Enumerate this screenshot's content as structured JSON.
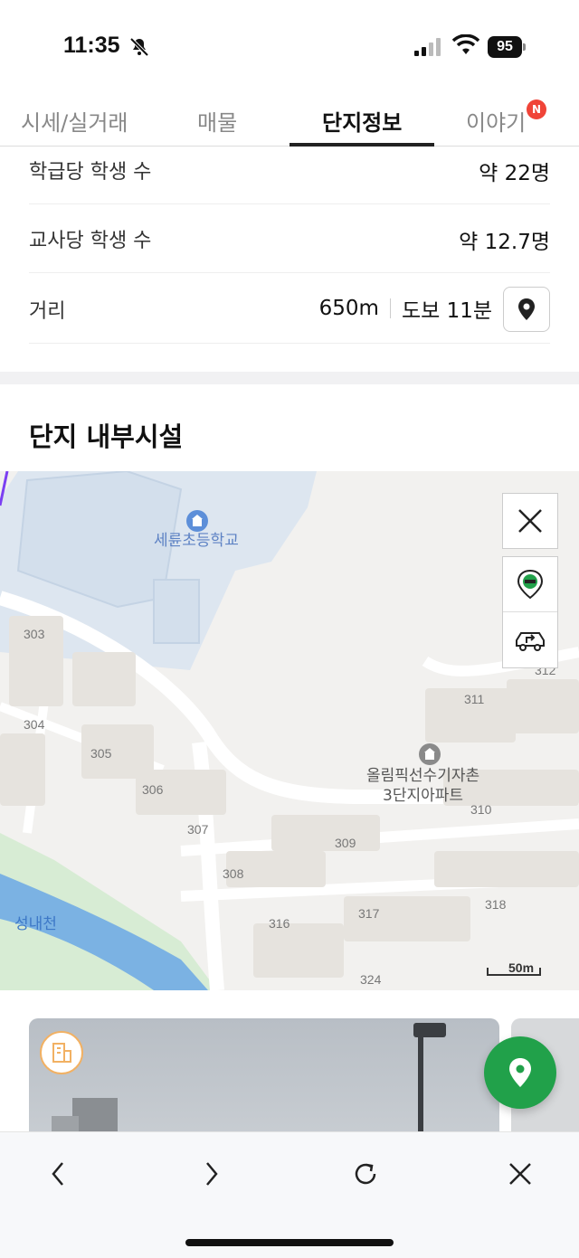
{
  "status_bar": {
    "time": "11:35",
    "battery": "95"
  },
  "tabs": [
    {
      "label": "시세/실거래"
    },
    {
      "label": "매물"
    },
    {
      "label": "단지정보"
    },
    {
      "label": "이야기"
    }
  ],
  "new_badge": "N",
  "info_rows": {
    "students_per_class": {
      "label": "학급당 학생 수",
      "value": "약 22명"
    },
    "students_per_teacher": {
      "label": "교사당 학생 수",
      "value": "약 12.7명"
    },
    "distance": {
      "label": "거리",
      "meters": "650m",
      "walk": "도보 11분"
    }
  },
  "facilities_title": "단지 내부시설",
  "map": {
    "school_name": "세륜초등학교",
    "apartment_name_line1": "올림픽선수기자촌",
    "apartment_name_line2": "3단지아파트",
    "stream_name": "성내천",
    "building_numbers": [
      "303",
      "304",
      "305",
      "306",
      "307",
      "308",
      "309",
      "310",
      "311",
      "312",
      "316",
      "317",
      "318",
      "324"
    ],
    "scale_label": "50m"
  },
  "colors": {
    "accent_green": "#21a14a",
    "badge_red": "#f04438",
    "active_tab": "#111111"
  }
}
